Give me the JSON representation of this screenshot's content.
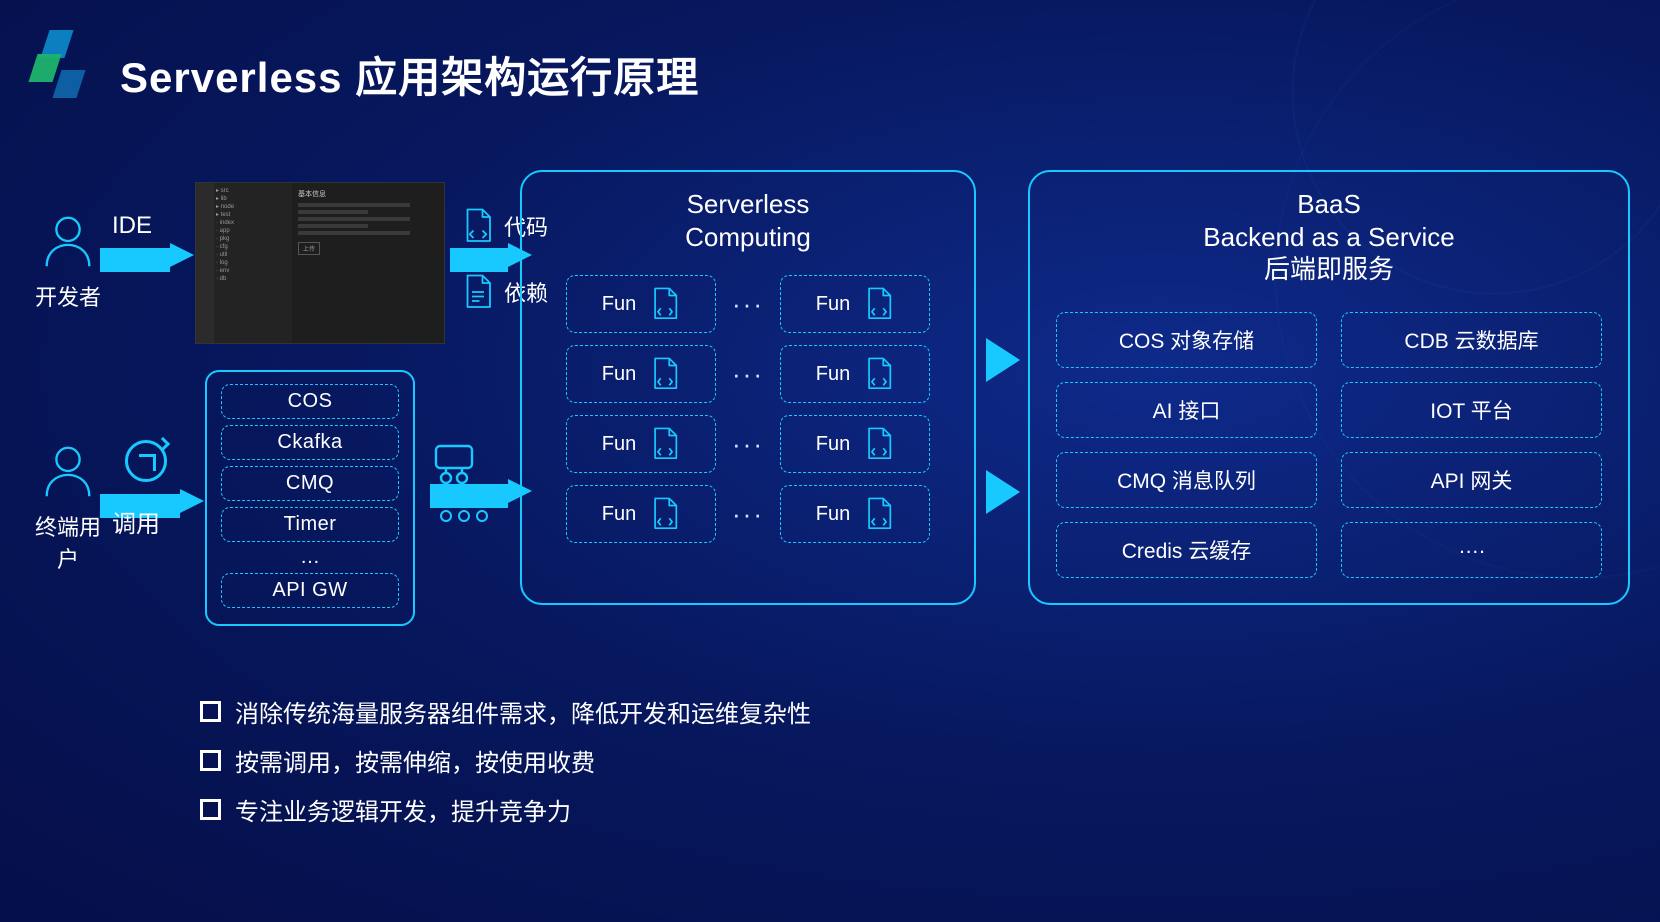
{
  "title": "Serverless 应用架构运行原理",
  "actors": {
    "developer": "开发者",
    "end_user": "终端用\n户"
  },
  "arrows": {
    "ide": "IDE",
    "invoke": "调用",
    "code": "代码",
    "deps": "依赖"
  },
  "triggers": {
    "items": [
      "COS",
      "Ckafka",
      "CMQ",
      "Timer"
    ],
    "more": "…",
    "last": "API GW"
  },
  "computing": {
    "title_l1": "Serverless",
    "title_l2": "Computing",
    "fun_label": "Fun",
    "row_dots": "···"
  },
  "baas": {
    "title_l1": "BaaS",
    "title_l2": "Backend as a Service",
    "title_l3": "后端即服务",
    "items": [
      "COS 对象存储",
      "CDB 云数据库",
      "AI 接口",
      "IOT 平台",
      "CMQ 消息队列",
      "API 网关",
      "Credis 云缓存",
      "…."
    ]
  },
  "bullets": [
    "消除传统海量服务器组件需求，降低开发和运维复杂性",
    "按需调用，按需伸缩，按使用收费",
    "专注业务逻辑开发，提升竞争力"
  ],
  "colors": {
    "cyan": "#18c9ff",
    "bg": "#07185f"
  }
}
